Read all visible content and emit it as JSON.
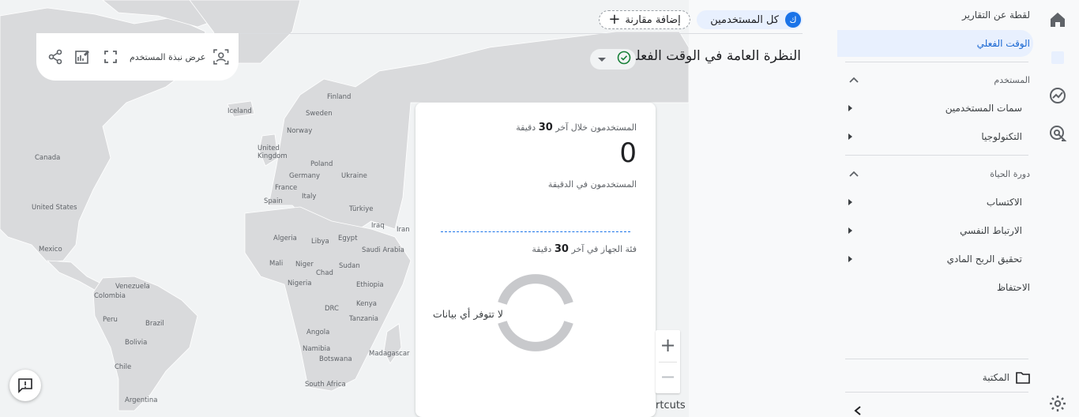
{
  "sidenav": {
    "reports_snapshot": "لقطة عن التقارير",
    "realtime": "الوقت الفعلي",
    "user_section": "المستخدم",
    "user_attributes": "سمات المستخدمين",
    "technology": "التكنولوجيا",
    "lifecycle_section": "دورة الحياة",
    "acquisition": "الاكتساب",
    "engagement": "الارتباط النفسي",
    "monetization": "تحقيق الربح المادي",
    "retention": "الاحتفاظ",
    "library": "المكتبة"
  },
  "rail": {
    "icons": [
      "home-icon",
      "reports-icon",
      "explore-icon",
      "advertising-icon",
      "settings-icon"
    ]
  },
  "header": {
    "audience_chip_avatar": "ك",
    "audience_chip_label": "كل المستخدمين",
    "add_comparison": "إضافة مقارنة",
    "title": "النظرة العامة في الوقت الفعلي",
    "user_snapshot": "عرض نبذة المستخدم"
  },
  "realtime_card": {
    "users_prefix": "المستخدمون خلال آخر",
    "users_minutes": "30",
    "users_suffix": "دقيقة",
    "users_count": "0",
    "users_per_minute": "المستخدمون في الدقيقة",
    "device_prefix": "فئة الجهاز في آخر",
    "device_minutes": "30",
    "device_suffix": "دقيقة",
    "no_data": "لا تتوفر أي بيانات"
  },
  "map": {
    "labels": {
      "finland": "Finland",
      "sweden": "Sweden",
      "iceland": "Iceland",
      "norway": "Norway",
      "uk": "United Kingdom",
      "poland": "Poland",
      "germany": "Germany",
      "ukraine": "Ukraine",
      "france": "France",
      "italy": "Italy",
      "spain": "Spain",
      "turkiye": "Türkiye",
      "iraq": "Iraq",
      "iran": "Iran",
      "algeria": "Algeria",
      "libya": "Libya",
      "egypt": "Egypt",
      "saudi": "Saudi Arabia",
      "mali": "Mali",
      "niger": "Niger",
      "chad": "Chad",
      "sudan": "Sudan",
      "nigeria": "Nigeria",
      "ethiopia": "Ethiopia",
      "drc": "DRC",
      "kenya": "Kenya",
      "tanzania": "Tanzania",
      "angola": "Angola",
      "namibia": "Namibia",
      "botswana": "Botswana",
      "madagascar": "Madagascar",
      "south_africa": "South Africa",
      "canada": "Canada",
      "usa": "United States",
      "mexico": "Mexico",
      "venezuela": "Venezuela",
      "colombia": "Colombia",
      "peru": "Peru",
      "brazil": "Brazil",
      "bolivia": "Bolivia",
      "chile": "Chile",
      "argentina": "Argentina"
    },
    "zoom_in": "+",
    "zoom_out": "−",
    "shortcuts": "rtcuts"
  },
  "colors": {
    "accent": "#1a73e8",
    "nav_active_bg": "#e8f0fe",
    "land": "#d9dadc",
    "success": "#188038"
  }
}
